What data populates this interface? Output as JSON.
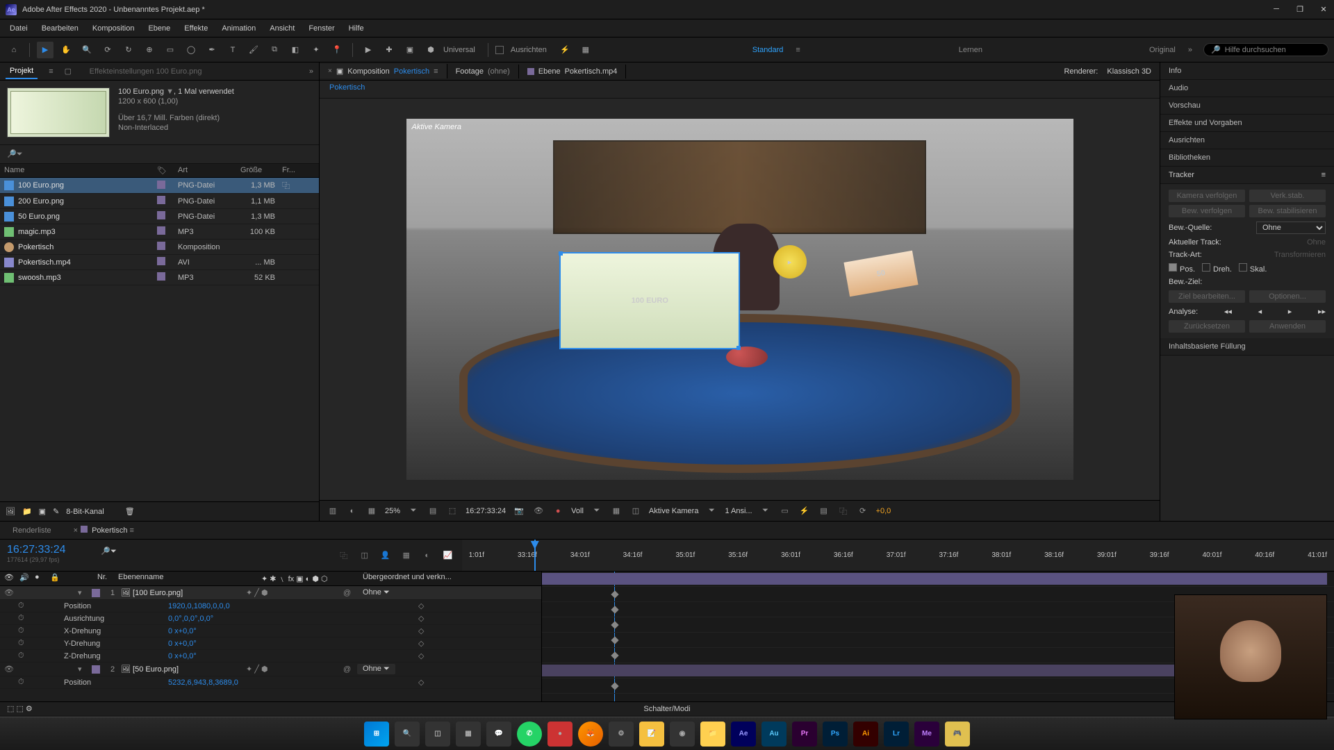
{
  "titlebar": {
    "title": "Adobe After Effects 2020 - Unbenanntes Projekt.aep *"
  },
  "menu": {
    "items": [
      "Datei",
      "Bearbeiten",
      "Komposition",
      "Ebene",
      "Effekte",
      "Animation",
      "Ansicht",
      "Fenster",
      "Hilfe"
    ]
  },
  "toolbar": {
    "universal": "Universal",
    "ausrichten": "Ausrichten",
    "workspaces": {
      "standard": "Standard",
      "lernen": "Lernen",
      "original": "Original"
    },
    "search_placeholder": "Hilfe durchsuchen"
  },
  "projectPanel": {
    "tab": "Projekt",
    "effectsTab": "Effekteinstellungen 100 Euro.png",
    "footage": {
      "name": "100 Euro.png",
      "used": ", 1 Mal verwendet",
      "dims": "1200 x 600 (1,00)",
      "colors": "Über 16,7 Mill. Farben (direkt)",
      "interlace": "Non-Interlaced"
    },
    "headers": {
      "name": "Name",
      "label": "",
      "art": "Art",
      "size": "Größe",
      "fr": "Fr..."
    },
    "items": [
      {
        "icon": "img",
        "name": "100 Euro.png",
        "art": "PNG-Datei",
        "size": "1,3 MB",
        "sel": true,
        "used": true
      },
      {
        "icon": "img",
        "name": "200 Euro.png",
        "art": "PNG-Datei",
        "size": "1,1 MB"
      },
      {
        "icon": "img",
        "name": "50 Euro.png",
        "art": "PNG-Datei",
        "size": "1,3 MB"
      },
      {
        "icon": "aud",
        "name": "magic.mp3",
        "art": "MP3",
        "size": "100 KB"
      },
      {
        "icon": "comp",
        "name": "Pokertisch",
        "art": "Komposition",
        "size": ""
      },
      {
        "icon": "vid",
        "name": "Pokertisch.mp4",
        "art": "AVI",
        "size": "... MB"
      },
      {
        "icon": "aud",
        "name": "swoosh.mp3",
        "art": "MP3",
        "size": "52 KB"
      }
    ],
    "footer": "8-Bit-Kanal"
  },
  "comp": {
    "tabs": {
      "composition": {
        "k": "Komposition",
        "v": "Pokertisch"
      },
      "footage": {
        "k": "Footage",
        "v": "(ohne)"
      },
      "layer": {
        "k": "Ebene",
        "v": "Pokertisch.mp4"
      }
    },
    "flow": "Pokertisch",
    "renderer": {
      "label": "Renderer:",
      "value": "Klassisch 3D"
    },
    "aktiveKamera": "Aktive Kamera",
    "note100": "100 EURO",
    "note50": "50",
    "highlightArrow": "▸",
    "viewertb": {
      "zoom": "25%",
      "time": "16:27:33:24",
      "res": "Voll",
      "view": "Aktive Kamera",
      "views": "1 Ansi...",
      "exposure": "+0,0"
    }
  },
  "rightPanels": {
    "info": "Info",
    "audio": "Audio",
    "vorschau": "Vorschau",
    "effekte": "Effekte und Vorgaben",
    "ausrichten": "Ausrichten",
    "biblio": "Bibliotheken",
    "tracker": {
      "title": "Tracker",
      "kameraVerfolgen": "Kamera verfolgen",
      "verkstab": "Verk.stab.",
      "bewVerfolgen": "Bew. verfolgen",
      "bewStab": "Bew. stabilisieren",
      "bewQuelle": "Bew.-Quelle:",
      "bewQuelleVal": "Ohne",
      "aktuellerTrack": "Aktueller Track:",
      "aktuellerTrackVal": "Ohne",
      "trackArt": "Track-Art:",
      "trackArtVal": "Transformieren",
      "pos": "Pos.",
      "dreh": "Dreh.",
      "skal": "Skal.",
      "bewZiel": "Bew.-Ziel:",
      "zielBearb": "Ziel bearbeiten...",
      "optionen": "Optionen...",
      "analyse": "Analyse:",
      "zuruck": "Zurücksetzen",
      "anwenden": "Anwenden"
    },
    "inhalt": "Inhaltsbasierte Füllung"
  },
  "timeline": {
    "tabs": {
      "renderliste": "Renderliste",
      "comp": "Pokertisch"
    },
    "timecode": "16:27:33:24",
    "subtc": "177614 (29,97 fps)",
    "ticks": [
      "1:01f",
      "33:16f",
      "34:01f",
      "34:16f",
      "35:01f",
      "35:16f",
      "36:01f",
      "36:16f",
      "37:01f",
      "37:16f",
      "38:01f",
      "38:16f",
      "39:01f",
      "39:16f",
      "40:01f",
      "40:16f",
      "41:01f"
    ],
    "colhead": {
      "nr": "Nr.",
      "ebene": "Ebenenname",
      "parent": "Übergeordnet und verkn..."
    },
    "layers": [
      {
        "num": "1",
        "name": "[100 Euro.png]",
        "parent": "Ohne",
        "sel": true,
        "props": [
          {
            "name": "Position",
            "val": "1920,0,1080,0,0,0"
          },
          {
            "name": "Ausrichtung",
            "val": "0,0°,0,0°,0,0°"
          },
          {
            "name": "X-Drehung",
            "val": "0 x+0,0°"
          },
          {
            "name": "Y-Drehung",
            "val": "0 x+0,0°"
          },
          {
            "name": "Z-Drehung",
            "val": "0 x+0,0°"
          }
        ]
      },
      {
        "num": "2",
        "name": "[50 Euro.png]",
        "parent": "Ohne",
        "props": [
          {
            "name": "Position",
            "val": "5232,6,943,8,3689,0"
          }
        ]
      }
    ],
    "footer": "Schalter/Modi"
  },
  "taskbar": {
    "apps": [
      "Win",
      "Srch",
      "Task",
      "Wdgt",
      "Tms",
      "WA",
      "Red",
      "FF",
      "Sky",
      "Nte",
      "OBS",
      "Fld",
      "Ae",
      "Au",
      "Pr",
      "Ps",
      "Ai",
      "Lr",
      "Me",
      "Gm"
    ]
  }
}
